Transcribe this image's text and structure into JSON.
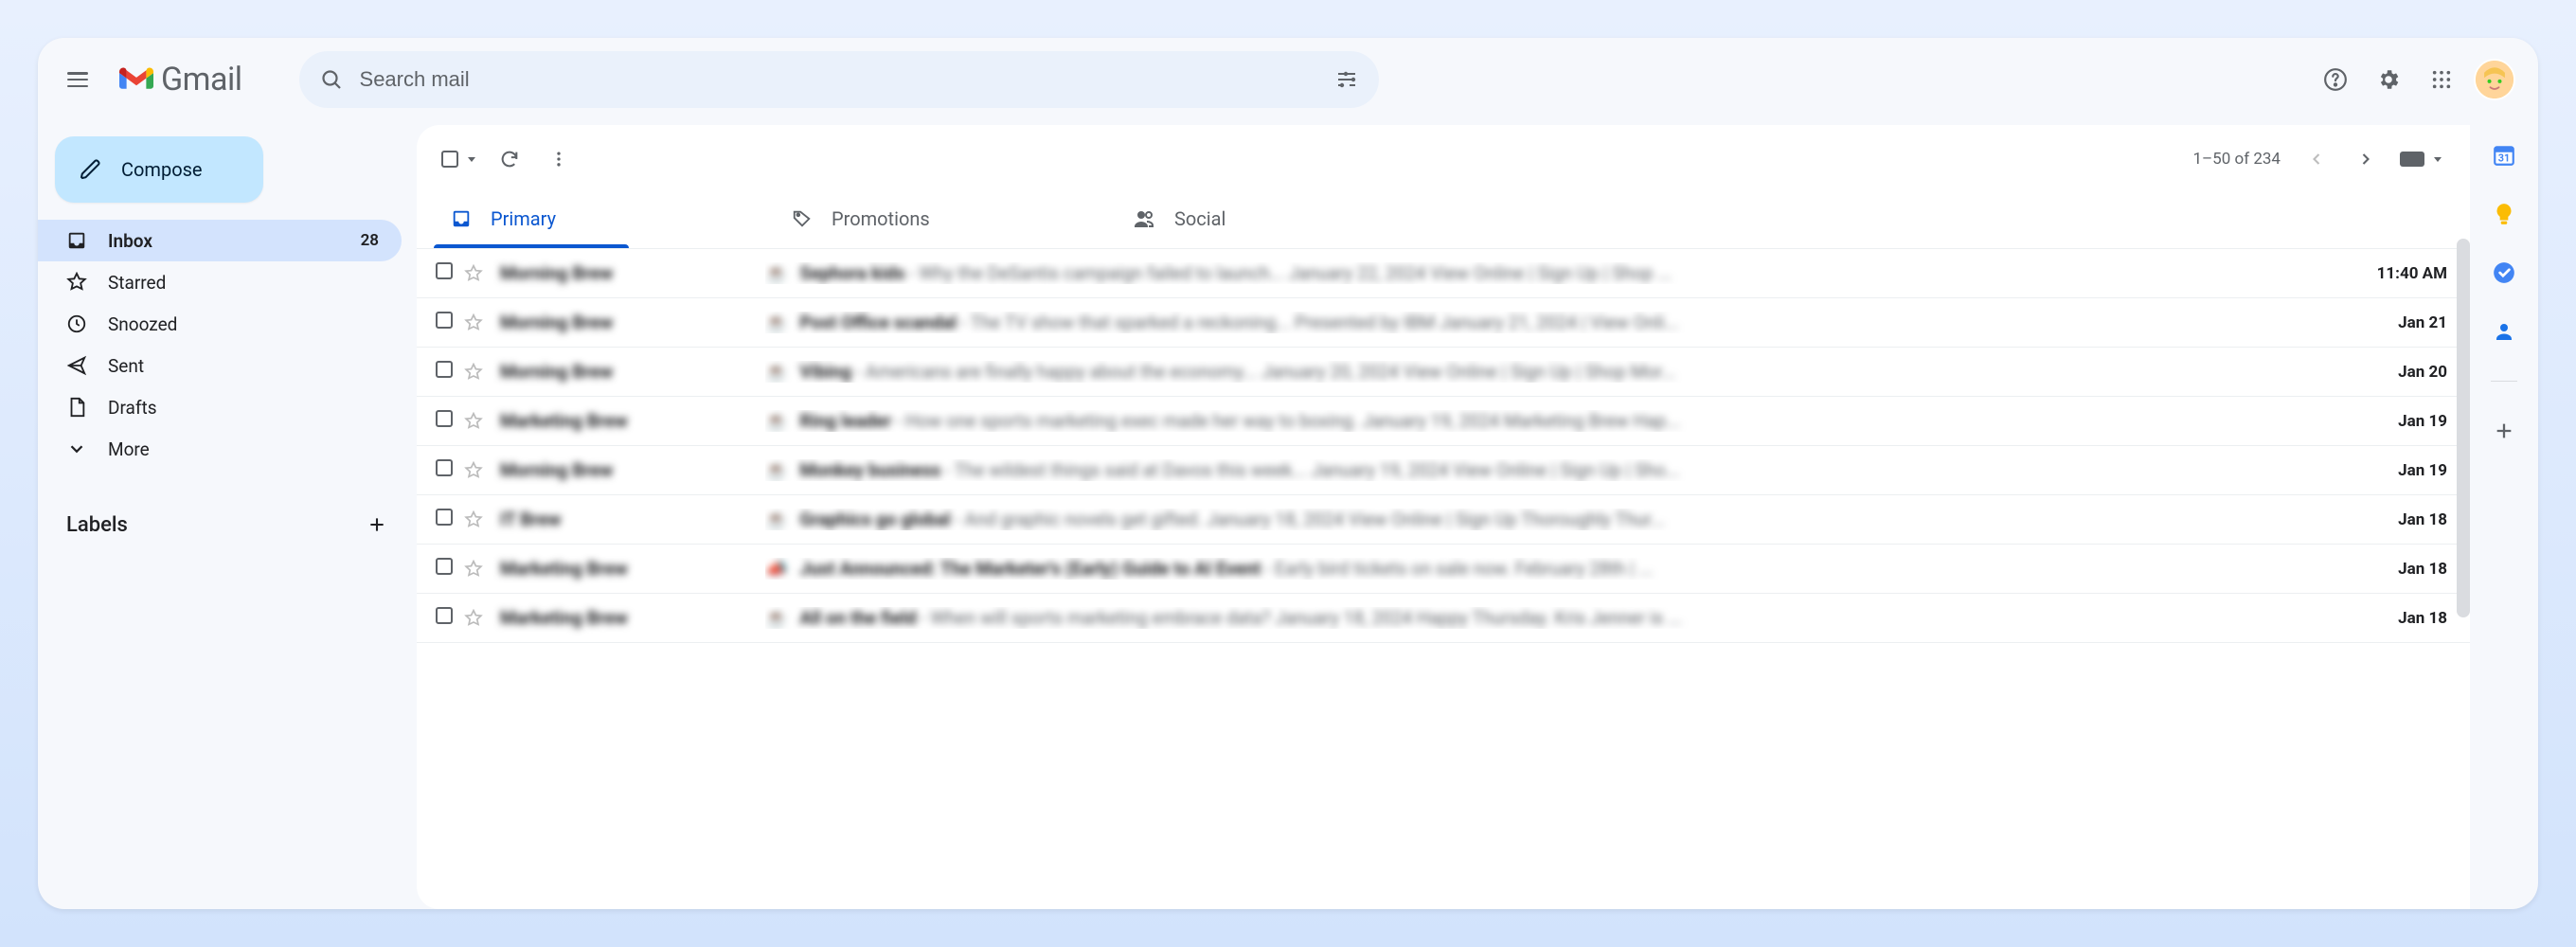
{
  "header": {
    "app_name": "Gmail",
    "search_placeholder": "Search mail"
  },
  "compose_label": "Compose",
  "nav": {
    "inbox": {
      "label": "Inbox",
      "count": "28"
    },
    "starred": {
      "label": "Starred"
    },
    "snoozed": {
      "label": "Snoozed"
    },
    "sent": {
      "label": "Sent"
    },
    "drafts": {
      "label": "Drafts"
    },
    "more": {
      "label": "More"
    }
  },
  "labels_header": "Labels",
  "toolbar": {
    "pagination": "1–50 of 234"
  },
  "tabs": {
    "primary": "Primary",
    "promotions": "Promotions",
    "social": "Social"
  },
  "emails": [
    {
      "sender": "Morning Brew",
      "emoji": "☕",
      "subject": "Sephora kids",
      "snippet": " - Why the DeSantis campaign failed to launch... January 22, 2024 View Online | Sign Up | Shop ...",
      "date": "11:40 AM"
    },
    {
      "sender": "Morning Brew",
      "emoji": "☕",
      "subject": "Post Office scandal",
      "snippet": " - The TV show that sparked a reckoning... Presented by IBM January 21, 2024 | View Onli...",
      "date": "Jan 21"
    },
    {
      "sender": "Morning Brew",
      "emoji": "☕",
      "subject": "Vibing",
      "snippet": " - Americans are finally happy about the economy... January 20, 2024 View Online | Sign Up | Shop Mor...",
      "date": "Jan 20"
    },
    {
      "sender": "Marketing Brew",
      "emoji": "☕",
      "subject": "Ring leader",
      "snippet": " - How one sports marketing exec made her way to boxing. January 19, 2024 Marketing Brew Hap...",
      "date": "Jan 19"
    },
    {
      "sender": "Morning Brew",
      "emoji": "☕",
      "subject": "Monkey business",
      "snippet": " - The wildest things said at Davos this week... January 19, 2024 View Online | Sign Up | Sho...",
      "date": "Jan 19"
    },
    {
      "sender": "IT Brew",
      "emoji": "☕",
      "subject": "Graphics go global",
      "snippet": " - And graphic novels get gifted. January 18, 2024 View Online | Sign Up Thoroughly Thur...",
      "date": "Jan 18"
    },
    {
      "sender": "Marketing Brew",
      "emoji": "📣",
      "subject": "Just Announced: The Marketer's (Early) Guide to AI Event",
      "snippet": " - Early bird tickets on sale now. February 28th | ...",
      "date": "Jan 18"
    },
    {
      "sender": "Marketing Brew",
      "emoji": "☕",
      "subject": "All on the field",
      "snippet": " - When will sports marketing embrace data? January 18, 2024 Happy Thursday. Kris Jenner is ...",
      "date": "Jan 18"
    }
  ]
}
